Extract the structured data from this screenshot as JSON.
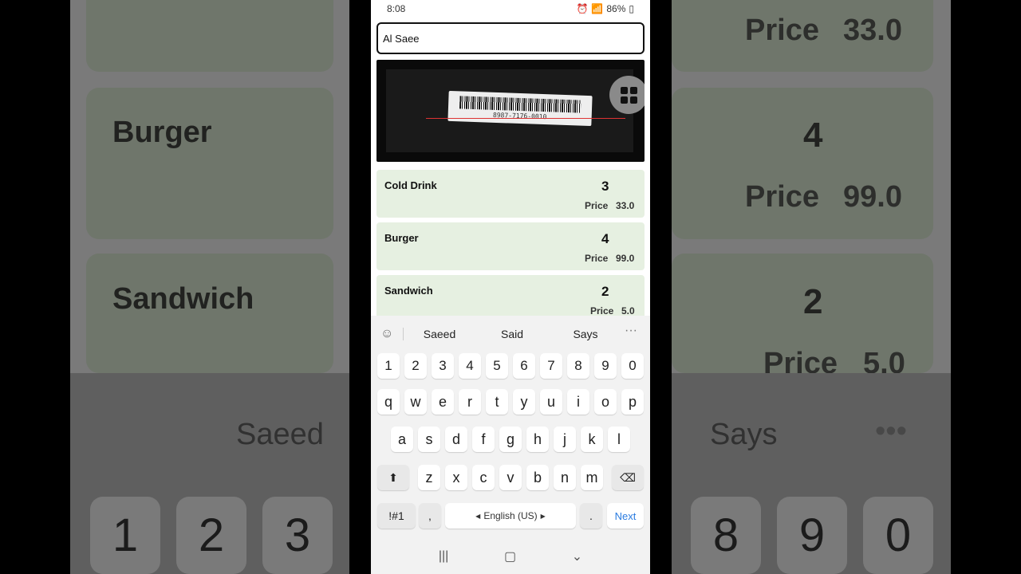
{
  "status": {
    "time": "8:08",
    "battery": "86%"
  },
  "search": {
    "value": "Al Saee"
  },
  "scanner": {
    "barcode_text": "8987-7176-0010"
  },
  "items": [
    {
      "name": "Cold Drink",
      "qty": "3",
      "price_label": "Price",
      "price": "33.0"
    },
    {
      "name": "Burger",
      "qty": "4",
      "price_label": "Price",
      "price": "99.0"
    },
    {
      "name": "Sandwich",
      "qty": "2",
      "price_label": "Price",
      "price": "5.0"
    }
  ],
  "keyboard": {
    "suggestions": [
      "Saeed",
      "Said",
      "Says"
    ],
    "row_numbers": [
      "1",
      "2",
      "3",
      "4",
      "5",
      "6",
      "7",
      "8",
      "9",
      "0"
    ],
    "row1": [
      "q",
      "w",
      "e",
      "r",
      "t",
      "y",
      "u",
      "i",
      "o",
      "p"
    ],
    "row2": [
      "a",
      "s",
      "d",
      "f",
      "g",
      "h",
      "j",
      "k",
      "l"
    ],
    "row3": [
      "z",
      "x",
      "c",
      "v",
      "b",
      "n",
      "m"
    ],
    "symbols_label": "!#1",
    "comma": ",",
    "space_label": "English (US)",
    "period": ".",
    "next_label": "Next"
  },
  "background": {
    "left_items": [
      "Burger",
      "Sandwich"
    ],
    "right_qtys": [
      "4",
      "2"
    ],
    "right_prices": [
      "33.0",
      "99.0",
      "5.0"
    ],
    "right_price_label": "Price",
    "suggest_left": "Saeed",
    "suggest_right": "Says",
    "left_keys": [
      "1",
      "2",
      "3"
    ],
    "right_keys": [
      "8",
      "9",
      "0"
    ]
  },
  "colors": {
    "card_bg": "#e6f0e1",
    "next_accent": "#2a7be0"
  }
}
